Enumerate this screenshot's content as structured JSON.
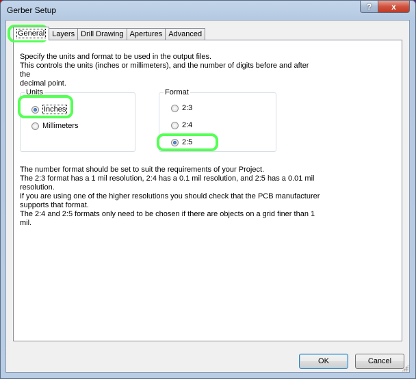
{
  "window": {
    "title": "Gerber Setup",
    "help_label": "?",
    "close_label": "x"
  },
  "tabs": [
    {
      "label": "General",
      "active": true
    },
    {
      "label": "Layers",
      "active": false
    },
    {
      "label": "Drill Drawing",
      "active": false
    },
    {
      "label": "Apertures",
      "active": false
    },
    {
      "label": "Advanced",
      "active": false
    }
  ],
  "intro": {
    "line1": "Specify the units and format to be used in the output files.",
    "line2": "This controls the units (inches or millimeters), and the number of digits before and after the",
    "line3": "decimal point."
  },
  "units": {
    "label": "Units",
    "options": [
      {
        "label": "Inches",
        "checked": true
      },
      {
        "label": "Millimeters",
        "checked": false
      }
    ]
  },
  "format": {
    "label": "Format",
    "options": [
      {
        "label": "2:3",
        "checked": false
      },
      {
        "label": "2:4",
        "checked": false
      },
      {
        "label": "2:5",
        "checked": true
      }
    ]
  },
  "notes": {
    "line1": "The number format should be set to suit the requirements of your Project.",
    "line2": "The 2:3 format has a 1 mil resolution, 2:4 has a 0.1 mil resolution, and 2:5 has a 0.01 mil",
    "line3": "resolution.",
    "line4": "If you are using one of the higher resolutions you should check that the PCB manufacturer",
    "line5": "supports that format.",
    "line6": "The 2:4 and 2:5 formats only need to be chosen if there are objects on a grid finer than 1",
    "line7": "mil."
  },
  "buttons": {
    "ok": "OK",
    "cancel": "Cancel"
  },
  "colors": {
    "highlight": "#55ff55"
  }
}
